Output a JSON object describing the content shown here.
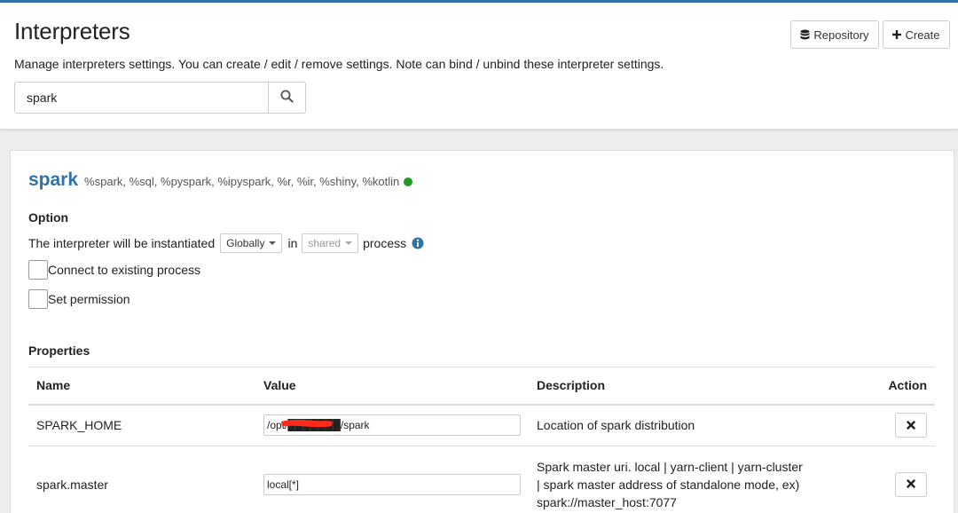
{
  "header": {
    "title": "Interpreters",
    "subtitle": "Manage interpreters settings. You can create / edit / remove settings. Note can bind / unbind these interpreter settings.",
    "repository_label": "Repository",
    "create_label": "Create",
    "search": {
      "value": "spark"
    }
  },
  "interpreter": {
    "name": "spark",
    "bindings": "%spark, %sql, %pyspark, %ipyspark, %r, %ir, %shiny, %kotlin",
    "status_color": "#1f9a22",
    "option": {
      "title": "Option",
      "instantiate_prefix": "The interpreter will be instantiated",
      "scope_value": "Globally",
      "word_in": "in",
      "mode_value": "shared",
      "word_process": "process",
      "connect_existing_label": "Connect to existing process",
      "set_permission_label": "Set permission"
    },
    "properties": {
      "title": "Properties",
      "columns": {
        "name": "Name",
        "value": "Value",
        "description": "Description",
        "action": "Action"
      },
      "rows": [
        {
          "name": "SPARK_HOME",
          "value": "/opt/███████/spark",
          "description": "Location of spark distribution"
        },
        {
          "name": "spark.master",
          "value": "local[*]",
          "description": "Spark master uri. local | yarn-client | yarn-cluster | spark master address of standalone mode, ex) spark://master_host:7077"
        }
      ]
    }
  },
  "colors": {
    "accent": "#3071a9",
    "running": "#1f9a22",
    "redaction": "#ff2a1a"
  },
  "icons": {
    "repository": "database-icon",
    "create": "plus-icon",
    "search": "search-icon",
    "info": "info-circle-icon",
    "delete": "close-icon"
  }
}
